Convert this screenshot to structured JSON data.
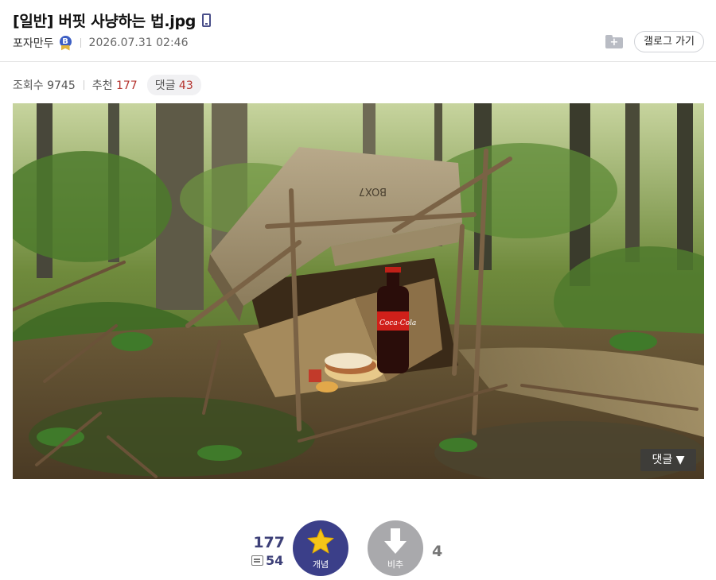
{
  "post": {
    "title": "[일반] 버핏 사냥하는 법.jpg",
    "author": "포자만두",
    "author_badge": "B",
    "date": "2026.07.31 02:46",
    "gallery_button": "갤로그 가기"
  },
  "stats": {
    "views_label": "조회수",
    "views": "9745",
    "recommend_label": "추천",
    "recommend": "177",
    "comments_label": "댓글",
    "comments": "43"
  },
  "image": {
    "box_text": "BOX7",
    "bottle_label": "Coca-Cola",
    "comment_toggle": "댓글 ▼"
  },
  "vote": {
    "up_count": "177",
    "fix_count": "54",
    "up_label": "개념",
    "down_label": "비추",
    "down_count": "4"
  },
  "colors": {
    "accent": "#3b3f89",
    "red": "#b5332e",
    "down_gray": "#a9a9ac"
  }
}
